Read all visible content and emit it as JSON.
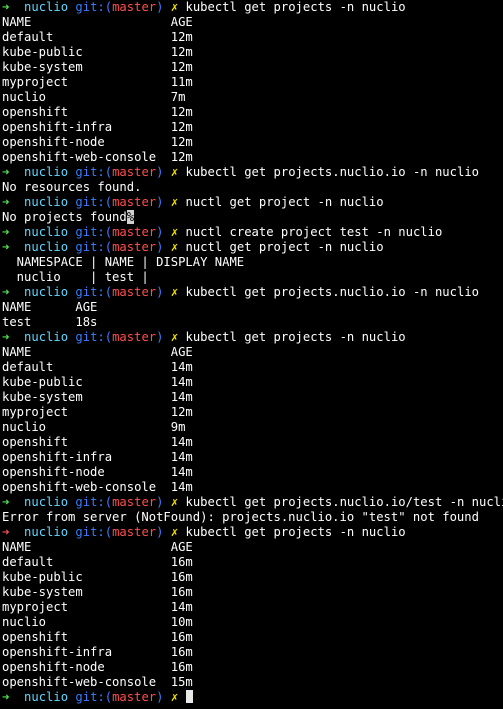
{
  "colors": {
    "background": "#000000",
    "text": "#ffffff",
    "prompt_arrow_ok": "#4ee44e",
    "prompt_arrow_error": "#ff4d4d",
    "directory": "#5fd7ff",
    "git_label": "#3a7cff",
    "branch": "#ff4d4d",
    "dirty_marker": "#f5e400"
  },
  "prompt": {
    "arrow": "➜",
    "dir": "nuclio",
    "git_open": "git:(",
    "branch": "master",
    "git_close": ")",
    "dirty": "✗"
  },
  "lines": [
    {
      "type": "prompt",
      "status": "ok",
      "command": "kubectl get projects -n nuclio"
    },
    {
      "type": "output",
      "text": "NAME                   AGE"
    },
    {
      "type": "output",
      "text": "default                12m"
    },
    {
      "type": "output",
      "text": "kube-public            12m"
    },
    {
      "type": "output",
      "text": "kube-system            12m"
    },
    {
      "type": "output",
      "text": "myproject              11m"
    },
    {
      "type": "output",
      "text": "nuclio                 7m"
    },
    {
      "type": "output",
      "text": "openshift              12m"
    },
    {
      "type": "output",
      "text": "openshift-infra        12m"
    },
    {
      "type": "output",
      "text": "openshift-node         12m"
    },
    {
      "type": "output",
      "text": "openshift-web-console  12m"
    },
    {
      "type": "prompt",
      "status": "ok",
      "command": "kubectl get projects.nuclio.io -n nuclio"
    },
    {
      "type": "output",
      "text": "No resources found."
    },
    {
      "type": "prompt",
      "status": "ok",
      "command": "nuctl get project -n nuclio"
    },
    {
      "type": "output_cursor",
      "text": "No projects found",
      "cursor_char": "%"
    },
    {
      "type": "prompt",
      "status": "ok",
      "command": "nuctl create project test -n nuclio"
    },
    {
      "type": "prompt",
      "status": "ok",
      "command": "nuctl get project -n nuclio"
    },
    {
      "type": "output",
      "text": "  NAMESPACE | NAME | DISPLAY NAME"
    },
    {
      "type": "output",
      "text": "  nuclio    | test |"
    },
    {
      "type": "prompt",
      "status": "ok",
      "command": "kubectl get projects.nuclio.io -n nuclio"
    },
    {
      "type": "output",
      "text": "NAME      AGE"
    },
    {
      "type": "output",
      "text": "test      18s"
    },
    {
      "type": "prompt",
      "status": "ok",
      "command": "kubectl get projects -n nuclio"
    },
    {
      "type": "output",
      "text": "NAME                   AGE"
    },
    {
      "type": "output",
      "text": "default                14m"
    },
    {
      "type": "output",
      "text": "kube-public            14m"
    },
    {
      "type": "output",
      "text": "kube-system            14m"
    },
    {
      "type": "output",
      "text": "myproject              12m"
    },
    {
      "type": "output",
      "text": "nuclio                 9m"
    },
    {
      "type": "output",
      "text": "openshift              14m"
    },
    {
      "type": "output",
      "text": "openshift-infra        14m"
    },
    {
      "type": "output",
      "text": "openshift-node         14m"
    },
    {
      "type": "output",
      "text": "openshift-web-console  14m"
    },
    {
      "type": "prompt",
      "status": "ok",
      "command": "kubectl get projects.nuclio.io/test -n nuclio"
    },
    {
      "type": "output",
      "text": "Error from server (NotFound): projects.nuclio.io \"test\" not found"
    },
    {
      "type": "prompt",
      "status": "error",
      "command": "kubectl get projects -n nuclio"
    },
    {
      "type": "output",
      "text": "NAME                   AGE"
    },
    {
      "type": "output",
      "text": "default                16m"
    },
    {
      "type": "output",
      "text": "kube-public            16m"
    },
    {
      "type": "output",
      "text": "kube-system            16m"
    },
    {
      "type": "output",
      "text": "myproject              14m"
    },
    {
      "type": "output",
      "text": "nuclio                 10m"
    },
    {
      "type": "output",
      "text": "openshift              16m"
    },
    {
      "type": "output",
      "text": "openshift-infra        16m"
    },
    {
      "type": "output",
      "text": "openshift-node         16m"
    },
    {
      "type": "output",
      "text": "openshift-web-console  15m"
    },
    {
      "type": "prompt_active",
      "status": "ok",
      "command": ""
    }
  ]
}
